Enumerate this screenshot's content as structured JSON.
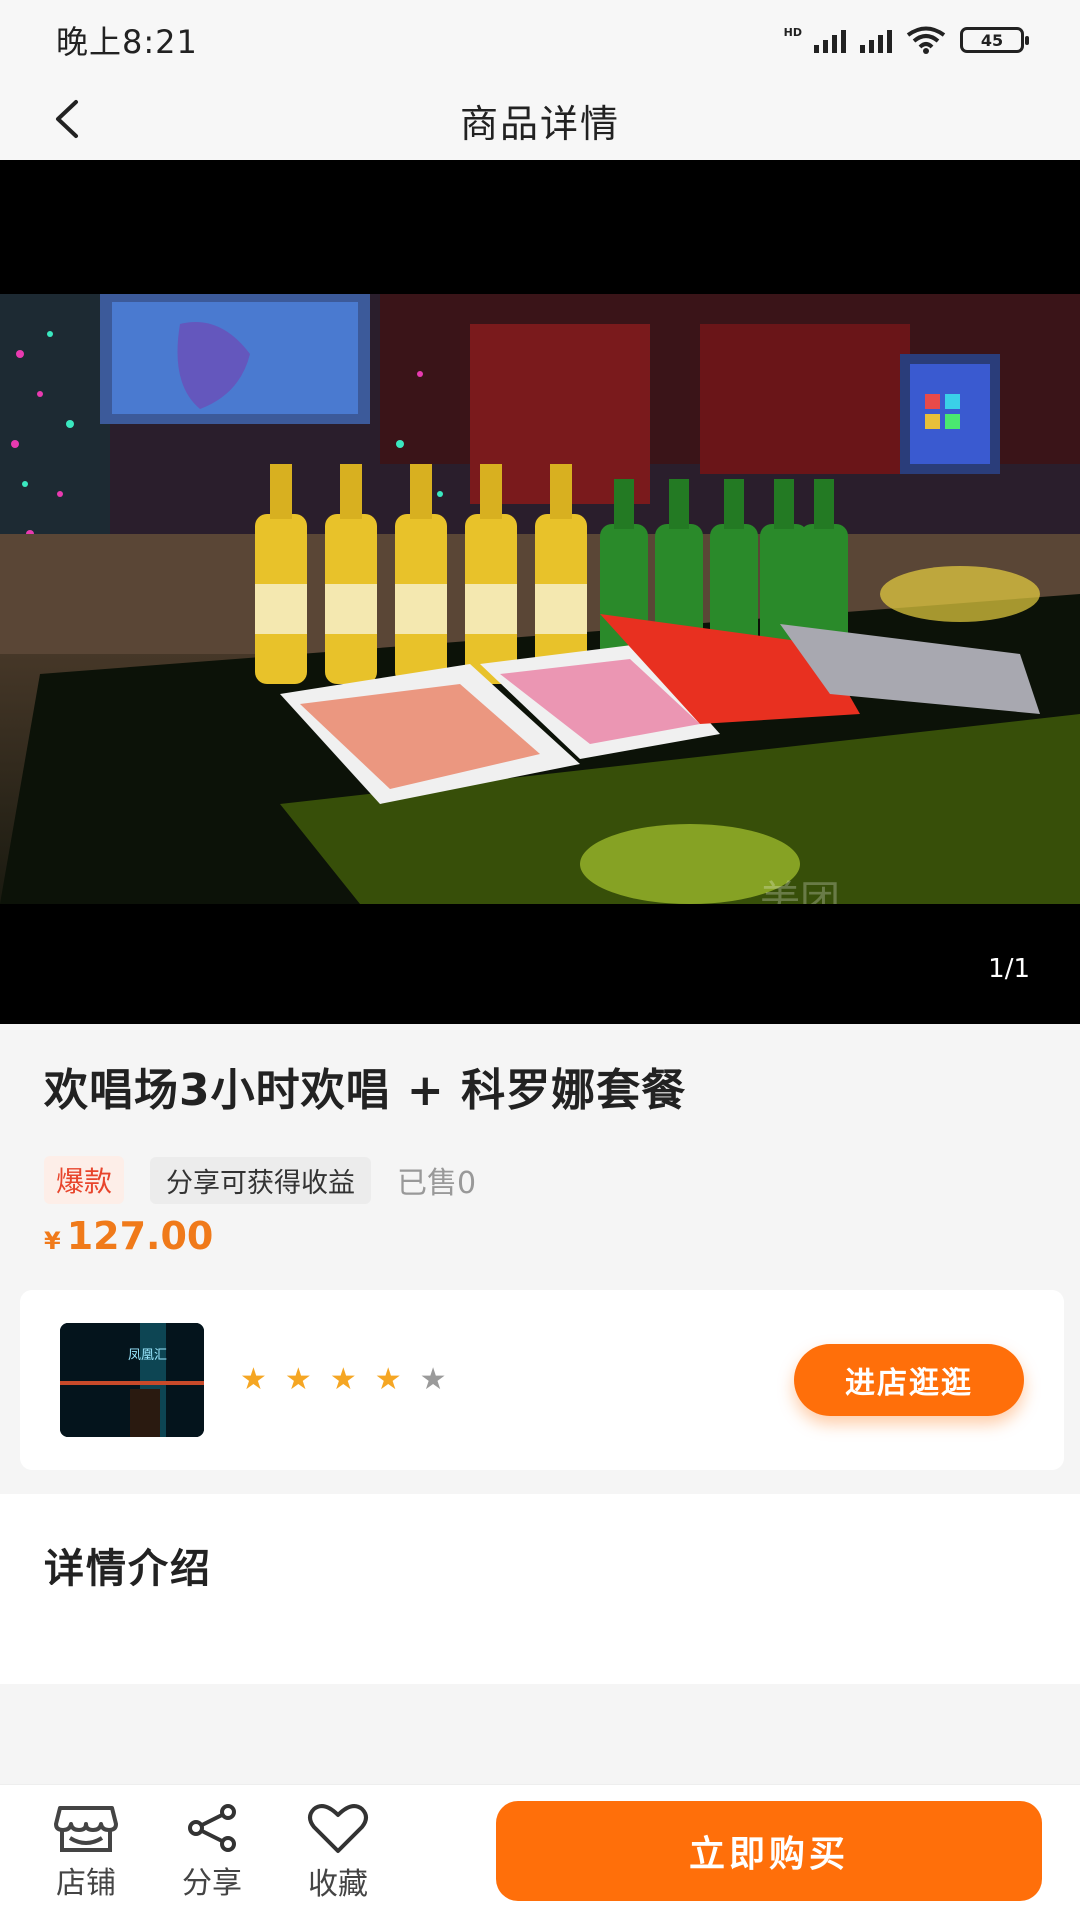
{
  "status_bar": {
    "time": "晚上8:21",
    "network_label": "HD",
    "battery": "45"
  },
  "nav": {
    "title": "商品详情",
    "back_icon": "chevron-left-icon"
  },
  "gallery": {
    "counter": "1/1",
    "watermark": "美团 美团一次美一 meituan.com"
  },
  "product": {
    "title": "欢唱场3小时欢唱 + 科罗娜套餐",
    "tag_hot": "爆款",
    "tag_share": "分享可获得收益",
    "sold": "已售0",
    "currency": "¥",
    "price": "127.00"
  },
  "shop": {
    "rating": 4,
    "rating_max": 5,
    "star_color_active": "#f5a623",
    "star_color_inactive": "#9a9a9a",
    "enter_label": "进店逛逛",
    "thumbnail_sign": "凤凰汇"
  },
  "detail": {
    "title": "详情介绍"
  },
  "bottom_bar": {
    "items": [
      {
        "label": "店铺",
        "icon": "store-icon"
      },
      {
        "label": "分享",
        "icon": "share-icon"
      },
      {
        "label": "收藏",
        "icon": "heart-icon"
      }
    ],
    "buy_label": "立即购买"
  },
  "colors": {
    "accent": "#ff6f0a",
    "price": "#f07a1a",
    "hot_tag": "#e8452c"
  }
}
